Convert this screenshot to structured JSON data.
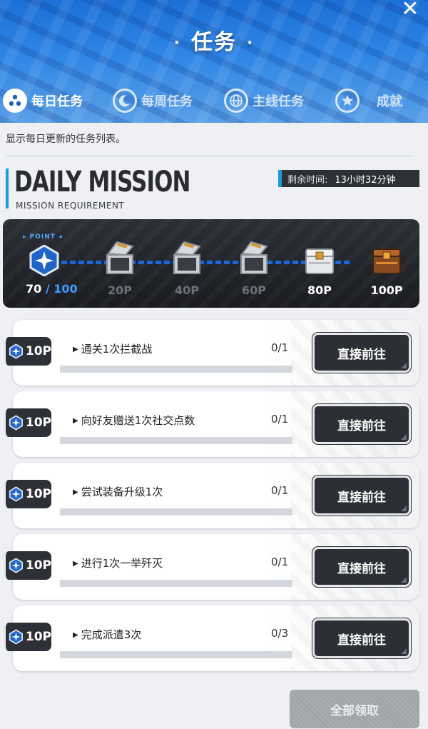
{
  "header": {
    "title": "任务",
    "title_dot": "·",
    "close_glyph": "✕"
  },
  "tabs": [
    {
      "label": "每日任务",
      "icon": "three-dots-icon",
      "active": true
    },
    {
      "label": "每周任务",
      "icon": "moon-icon",
      "active": false
    },
    {
      "label": "主线任务",
      "icon": "globe-icon",
      "active": false
    },
    {
      "label": "成就",
      "icon": "star-icon",
      "active": false
    }
  ],
  "description": "显示每日更新的任务列表。",
  "daily": {
    "title": "DAILY MISSION",
    "subtitle": "MISSION REQUIREMENT",
    "remaining_label": "剩余时间:",
    "remaining_value": "13小时32分钟"
  },
  "progress": {
    "point_tag": "POINT",
    "current": "70",
    "separator": " / ",
    "max": "100",
    "milestones": [
      {
        "label": "20P",
        "claimed": true
      },
      {
        "label": "40P",
        "claimed": true
      },
      {
        "label": "60P",
        "claimed": true
      },
      {
        "label": "80P",
        "claimed": false
      },
      {
        "label": "100P",
        "claimed": false
      }
    ]
  },
  "missions": [
    {
      "reward": "10P",
      "text": "通关1次拦截战",
      "count": "0/1",
      "progress": 0,
      "button": "直接前往"
    },
    {
      "reward": "10P",
      "text": "向好友赠送1次社交点数",
      "count": "0/1",
      "progress": 0,
      "button": "直接前往"
    },
    {
      "reward": "10P",
      "text": "尝试装备升级1次",
      "count": "0/1",
      "progress": 0,
      "button": "直接前往"
    },
    {
      "reward": "10P",
      "text": "进行1次一举歼灭",
      "count": "0/1",
      "progress": 0,
      "button": "直接前往"
    },
    {
      "reward": "10P",
      "text": "完成派遣3次",
      "count": "0/3",
      "progress": 0,
      "button": "直接前往"
    }
  ],
  "claim_all_label": "全部领取",
  "colors": {
    "accent_blue": "#1c9bd8",
    "dark_panel": "#2d3036",
    "header_blue": "#2f86e6"
  }
}
